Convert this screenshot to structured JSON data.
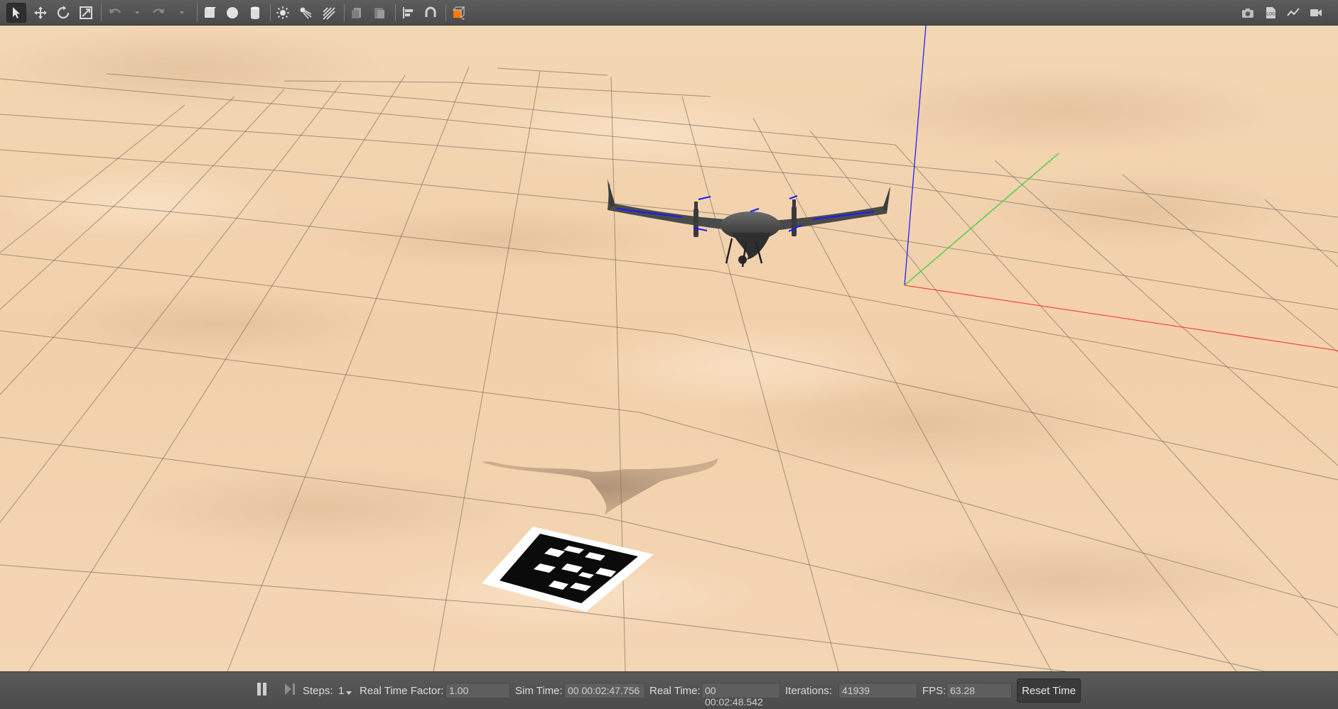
{
  "toolbar": {
    "left_tools": [
      "select-mode-icon",
      "translate-mode-icon",
      "rotate-mode-icon",
      "scale-mode-icon",
      "undo-icon",
      "redo-icon",
      "box-shape-icon",
      "sphere-shape-icon",
      "cylinder-shape-icon",
      "point-light-icon",
      "spot-light-icon",
      "directional-light-icon",
      "copy-icon",
      "paste-icon",
      "align-icon",
      "snap-icon",
      "view-angle-icon"
    ],
    "right_tools": [
      "screenshot-icon",
      "log-icon",
      "plot-icon",
      "record-video-icon"
    ],
    "active_tool": "select-mode-icon",
    "accent_color": "#ff7a00",
    "log_icon_label": "LOG"
  },
  "scene": {
    "sky_color": "#efcfaa",
    "grid_color": "#6b6256",
    "axis_colors": {
      "x": "#ff2a2a",
      "y": "#38d038",
      "z": "#2020ff"
    },
    "model": "fixed-wing VTOL drone",
    "marker": "AprilTag landing pad"
  },
  "bottom": {
    "pause_icon": "pause-icon",
    "step_icon": "step-icon",
    "steps_label": "Steps:",
    "steps_value": "1",
    "rtf_label": "Real Time Factor:",
    "rtf_value": "1.00",
    "sim_time_label": "Sim Time:",
    "sim_time_value": "00 00:02:47.756",
    "real_time_label": "Real Time:",
    "real_time_value": "00 00:02:48.542",
    "iterations_label": "Iterations:",
    "iterations_value": "41939",
    "fps_label": "FPS:",
    "fps_value": "63.28",
    "reset_label": "Reset Time"
  }
}
